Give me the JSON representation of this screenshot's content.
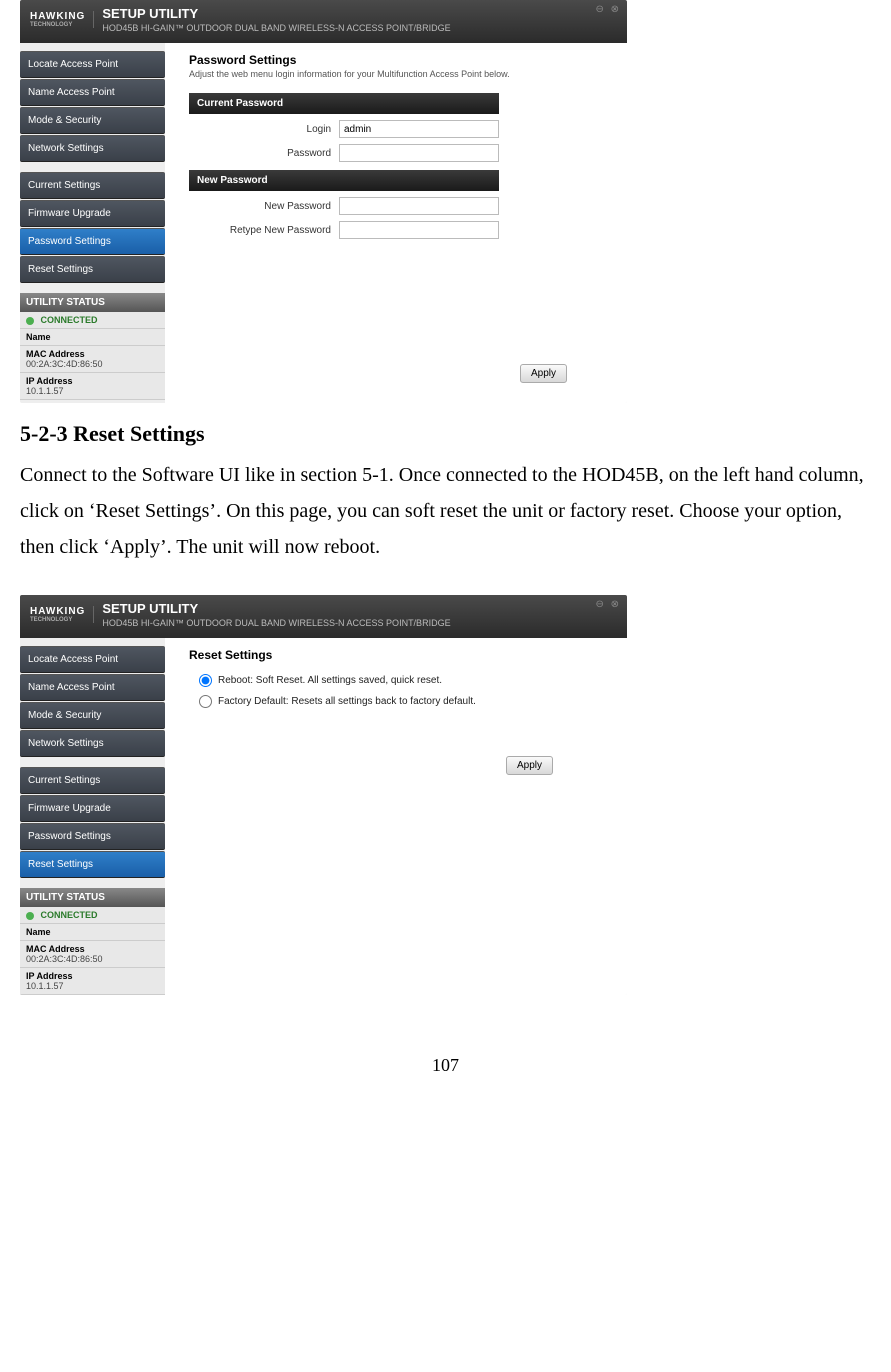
{
  "page_number": "107",
  "section": {
    "heading": "5-2-3 Reset Settings",
    "body": "Connect to the Software UI like in section 5-1.    Once connected to the HOD45B, on the left hand column, click on ‘Reset Settings’.    On this page, you can soft reset the unit or factory reset.    Choose your option, then click ‘Apply’. The unit will now reboot."
  },
  "shot1": {
    "brand": "HAWKING",
    "brand_sub": "TECHNOLOGY",
    "title": "SETUP UTILITY",
    "subtitle": "HOD45B HI-GAIN™ OUTDOOR DUAL BAND WIRELESS-N ACCESS POINT/BRIDGE",
    "nav1": [
      "Locate Access Point",
      "Name Access Point",
      "Mode & Security",
      "Network Settings"
    ],
    "nav2": [
      "Current Settings",
      "Firmware Upgrade",
      "Password Settings",
      "Reset Settings"
    ],
    "active": "Password Settings",
    "status_head": "UTILITY STATUS",
    "status_conn": "CONNECTED",
    "status_name_lbl": "Name",
    "status_mac_lbl": "MAC Address",
    "status_mac": "00:2A:3C:4D:86:50",
    "status_ip_lbl": "IP Address",
    "status_ip": "10.1.1.57",
    "page_title": "Password Settings",
    "page_sub": "Adjust the web menu login information for your Multifunction Access Point below.",
    "bar_current": "Current Password",
    "login_lbl": "Login",
    "login_val": "admin",
    "pass_lbl": "Password",
    "bar_new": "New Password",
    "newpass_lbl": "New Password",
    "retype_lbl": "Retype New Password",
    "apply": "Apply"
  },
  "shot2": {
    "brand": "HAWKING",
    "brand_sub": "TECHNOLOGY",
    "title": "SETUP UTILITY",
    "subtitle": "HOD45B HI-GAIN™ OUTDOOR DUAL BAND WIRELESS-N ACCESS POINT/BRIDGE",
    "nav1": [
      "Locate Access Point",
      "Name Access Point",
      "Mode & Security",
      "Network Settings"
    ],
    "nav2": [
      "Current Settings",
      "Firmware Upgrade",
      "Password Settings",
      "Reset Settings"
    ],
    "active": "Reset Settings",
    "status_head": "UTILITY STATUS",
    "status_conn": "CONNECTED",
    "status_name_lbl": "Name",
    "status_mac_lbl": "MAC Address",
    "status_mac": "00:2A:3C:4D:86:50",
    "status_ip_lbl": "IP Address",
    "status_ip": "10.1.1.57",
    "page_title": "Reset Settings",
    "opt1": "Reboot: Soft Reset. All settings saved, quick reset.",
    "opt2": "Factory Default: Resets all settings back to factory default.",
    "apply": "Apply"
  }
}
